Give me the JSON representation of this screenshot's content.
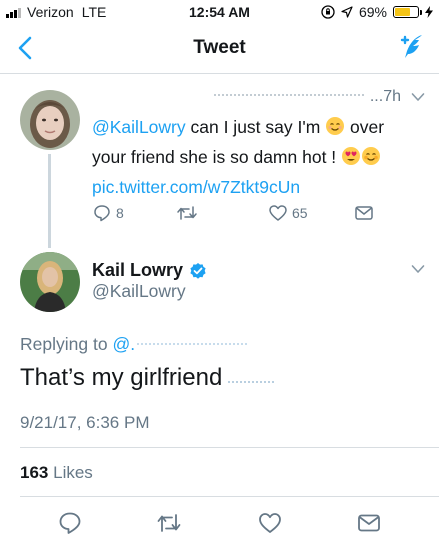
{
  "status_bar": {
    "carrier": "Verizon",
    "network": "LTE",
    "time": "12:54 AM",
    "battery": "69%",
    "battery_level": 0.69
  },
  "nav": {
    "title": "Tweet"
  },
  "parent_tweet": {
    "header_partial": "...7h",
    "text_line1_mention": "@KailLowry",
    "text_line1_rest": " can I just say I'm",
    "text_line1_after_emoji": " over",
    "text_line2": "your friend she is so damn hot !",
    "link": "pic.twitter.com/w7Ztkt9cUn",
    "replies": "8",
    "likes": "65"
  },
  "main_tweet": {
    "name": "Kail Lowry",
    "handle": "@KailLowry",
    "replying_label": "Replying to",
    "replying_mention": "@.",
    "text": "That’s my girlfriend",
    "timestamp": "9/21/17, 6:36 PM",
    "likes_count": "163",
    "likes_label": "Likes"
  },
  "colors": {
    "accent": "#1da1f2",
    "secondary_text": "#657786",
    "primary_text": "#14171a",
    "verified": "#1da1f2"
  }
}
